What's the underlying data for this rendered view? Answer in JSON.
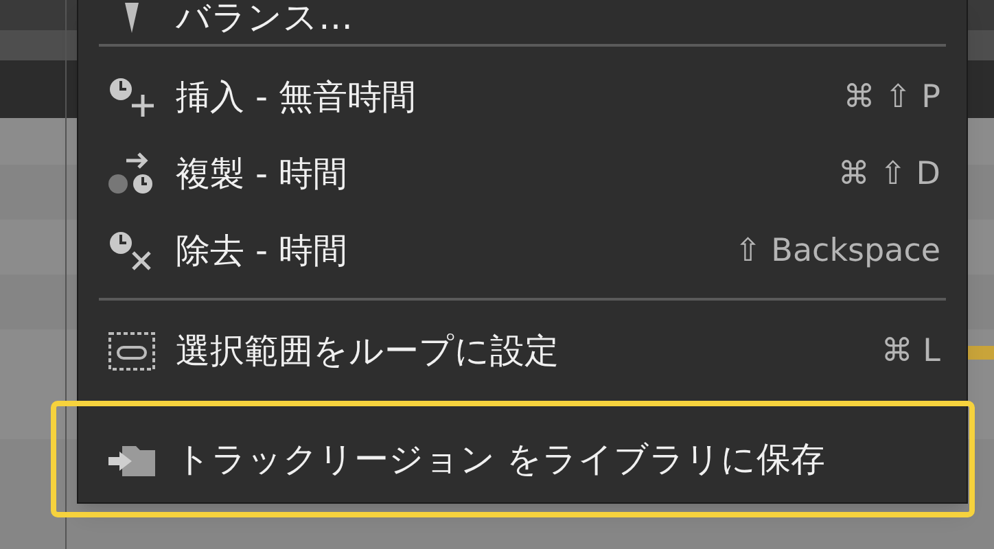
{
  "menu": {
    "items": [
      {
        "kind": "balance",
        "label": "バランス…",
        "highlighted": false
      },
      {
        "kind": "separator"
      },
      {
        "kind": "insert",
        "label": "挿入 - 無音時間",
        "shortcut": "⌘ ⇧ P",
        "highlighted": false
      },
      {
        "kind": "duplicate",
        "label": "複製 - 時間",
        "shortcut": "⌘ ⇧ D",
        "highlighted": false
      },
      {
        "kind": "remove",
        "label": "除去 - 時間",
        "shortcut": "⇧ Backspace",
        "highlighted": false
      },
      {
        "kind": "separator"
      },
      {
        "kind": "loop",
        "label": "選択範囲をループに設定",
        "shortcut": "⌘ L",
        "highlighted": false
      },
      {
        "kind": "save",
        "label": "トラックリージョン をライブラリに保存",
        "highlighted": true
      }
    ]
  }
}
